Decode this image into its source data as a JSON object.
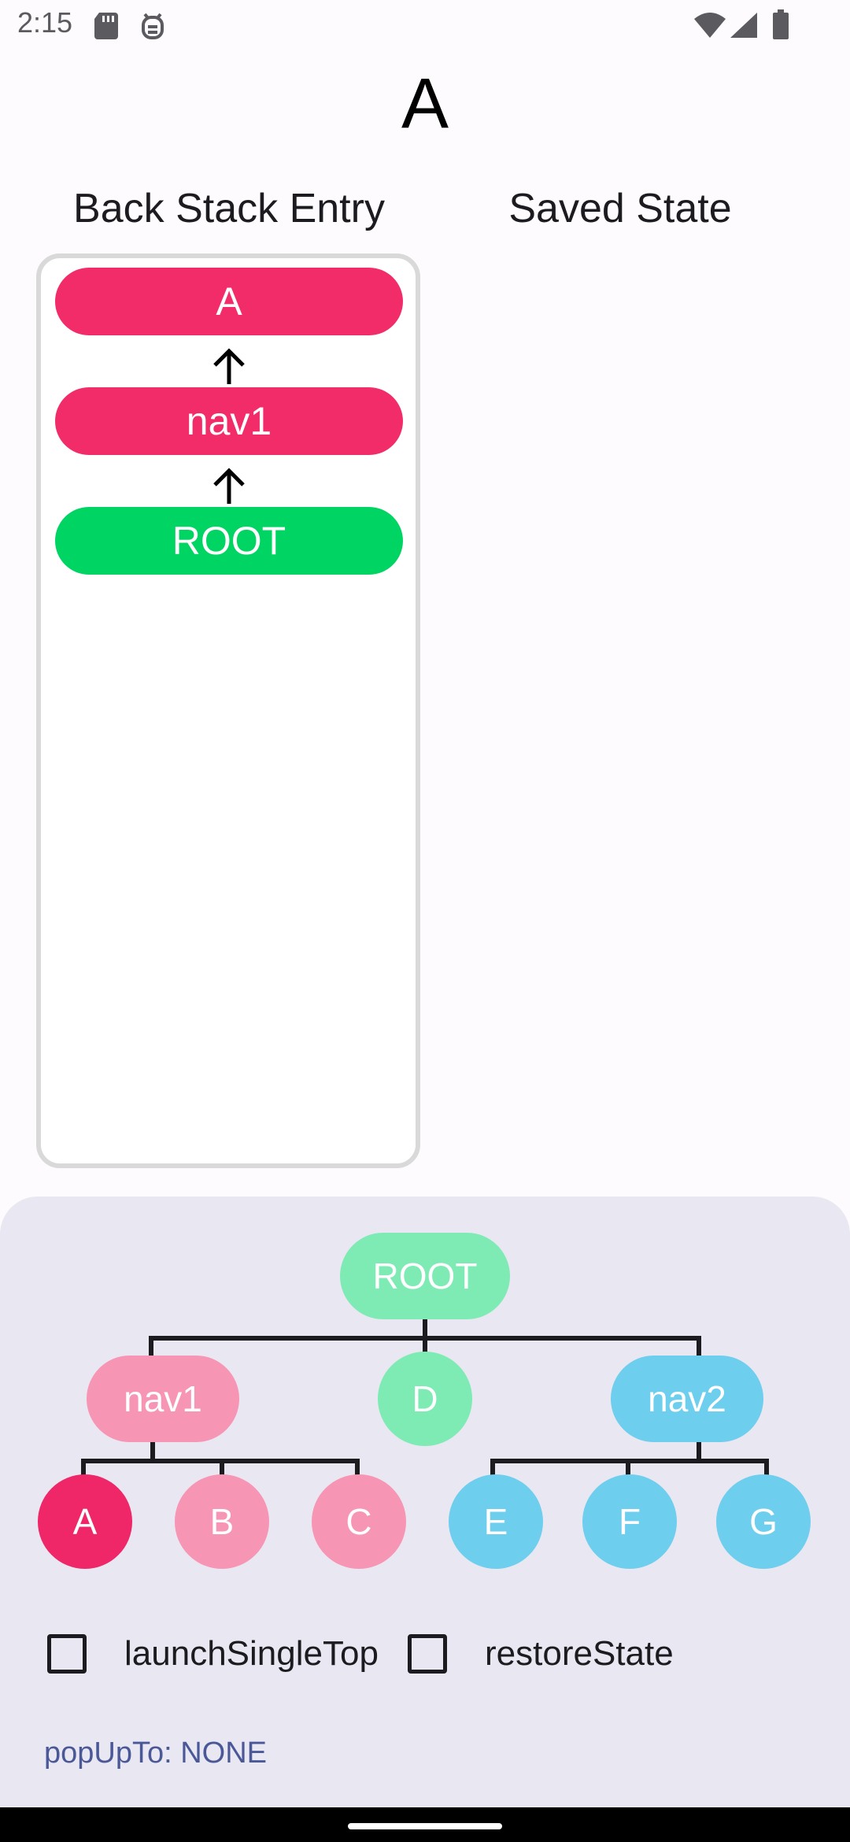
{
  "status_bar": {
    "time": "2:15",
    "left_icons": [
      "sd-card-icon",
      "debug-icon"
    ],
    "right_icons": [
      "wifi-icon",
      "signal-icon",
      "battery-icon"
    ]
  },
  "title": "A",
  "columns": {
    "back_stack_header": "Back Stack Entry",
    "saved_state_header": "Saved State"
  },
  "back_stack": [
    {
      "label": "A",
      "color": "#F22B69"
    },
    {
      "label": "nav1",
      "color": "#F22B69"
    },
    {
      "label": "ROOT",
      "color": "#00D462"
    }
  ],
  "tree": {
    "root": {
      "label": "ROOT",
      "color": "#7EEBB4"
    },
    "nav1": {
      "label": "nav1",
      "color": "#F695B4"
    },
    "d": {
      "label": "D",
      "color": "#7EEBB4"
    },
    "nav2": {
      "label": "nav2",
      "color": "#6DCEEE"
    },
    "a": {
      "label": "A",
      "color": "#EF2667",
      "selected": true
    },
    "b": {
      "label": "B",
      "color": "#F695B4"
    },
    "c": {
      "label": "C",
      "color": "#F695B4"
    },
    "e": {
      "label": "E",
      "color": "#6DCEEE"
    },
    "f": {
      "label": "F",
      "color": "#6DCEEE"
    },
    "g": {
      "label": "G",
      "color": "#6DCEEE"
    }
  },
  "options": {
    "launch_single_top": {
      "label": "launchSingleTop",
      "checked": false
    },
    "restore_state": {
      "label": "restoreState",
      "checked": false
    }
  },
  "pop_up_to": "popUpTo: NONE"
}
